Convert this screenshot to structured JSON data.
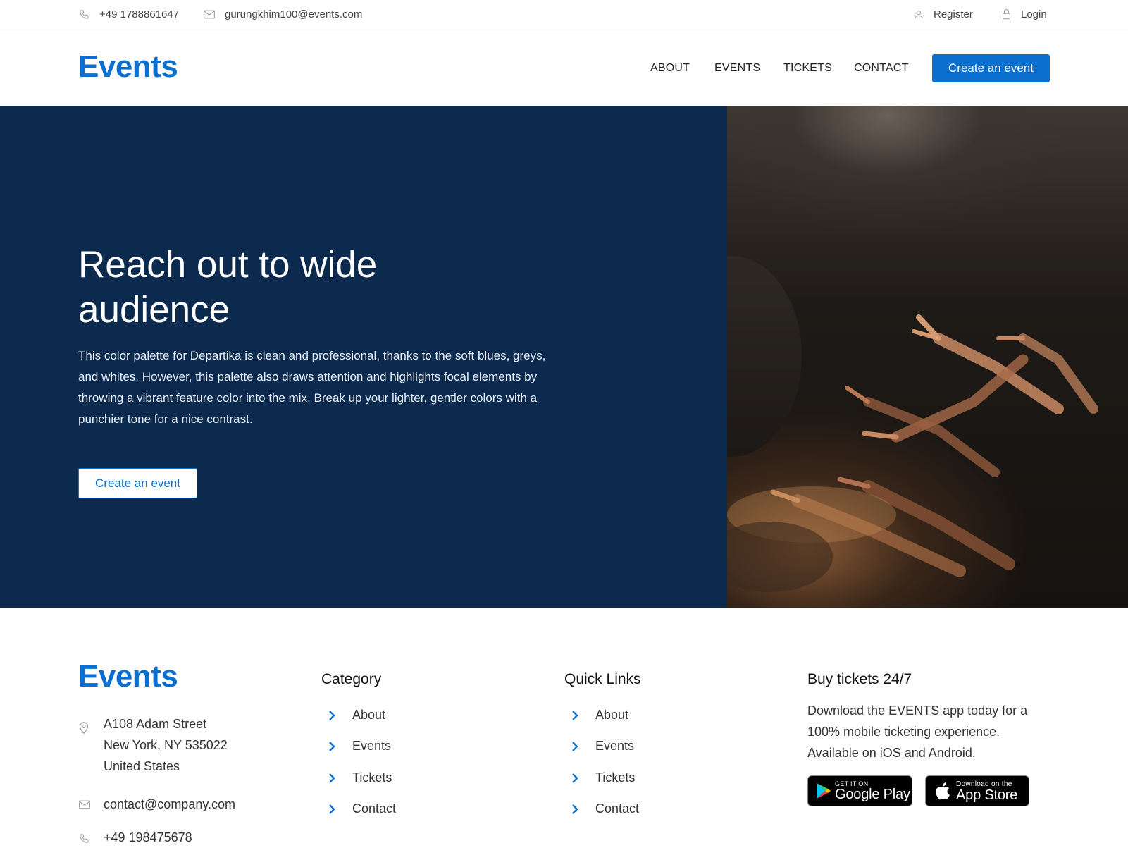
{
  "topbar": {
    "phone": "+49 1788861647",
    "email": "gurungkhim100@events.com",
    "register": "Register",
    "login": "Login"
  },
  "brand": {
    "logo": "Events",
    "accent": "#0b6fd0",
    "hero_bg": "#0b2a4e"
  },
  "nav": {
    "items": [
      "ABOUT",
      "EVENTS",
      "TICKETS",
      "CONTACT"
    ],
    "cta": "Create an event"
  },
  "hero": {
    "title": "Reach out to wide audience",
    "body": "This color palette for Departika is clean and professional, thanks to the soft blues, greys, and whites. However, this palette also draws attention and highlights focal elements by throwing a vibrant feature color into the mix. Break up your lighter, gentler colors with a punchier tone for a nice contrast.",
    "button": "Create an event"
  },
  "footer": {
    "logo": "Events",
    "address": [
      "A108 Adam Street",
      "New York, NY 535022",
      "United States"
    ],
    "email": "contact@company.com",
    "phone": "+49 198475678",
    "category": {
      "title": "Category",
      "links": [
        "About",
        "Events",
        "Tickets",
        "Contact"
      ]
    },
    "quick_links": {
      "title": "Quick Links",
      "links": [
        "About",
        "Events",
        "Tickets",
        "Contact"
      ]
    },
    "app": {
      "title": "Buy tickets 24/7",
      "text_lines": [
        "Download the EVENTS app today for a",
        "100% mobile ticketing experience.",
        "Available on iOS and Android."
      ],
      "google_small": "GET IT ON",
      "google_big": "Google Play",
      "apple_small": "Download on the",
      "apple_big": "App Store"
    }
  }
}
